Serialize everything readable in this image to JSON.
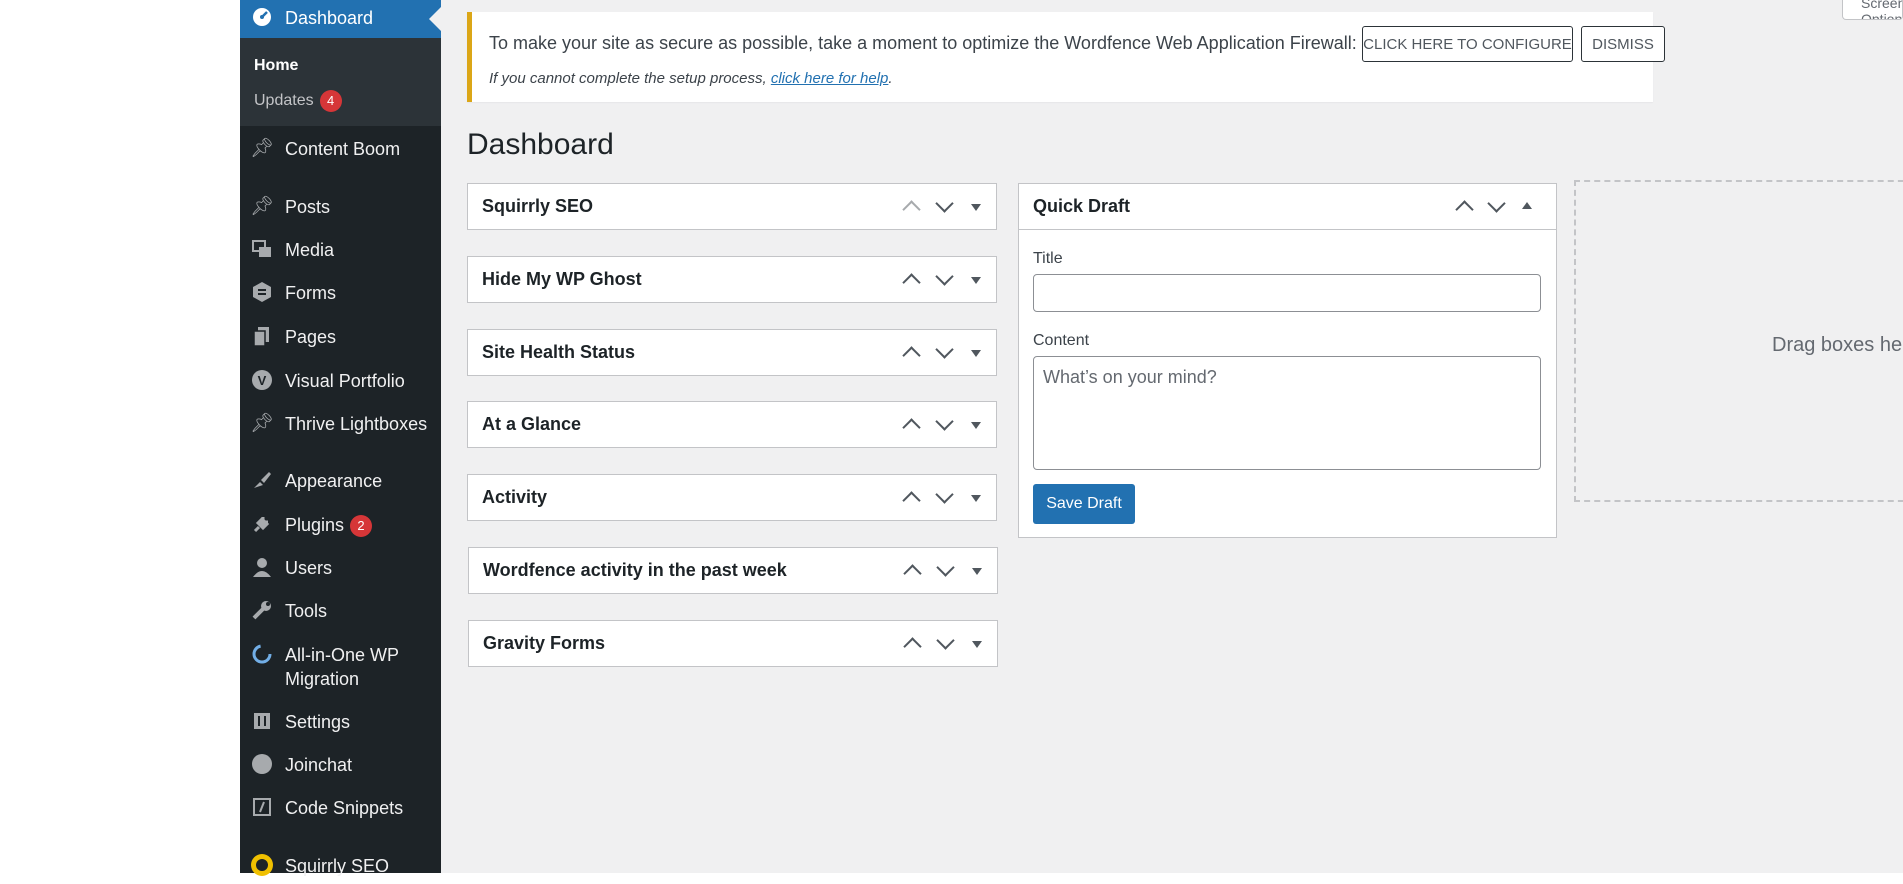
{
  "sidebar": {
    "dashboard_label": "Dashboard",
    "submenu": {
      "home": "Home",
      "updates": "Updates",
      "updates_count": "4"
    },
    "items": [
      {
        "label": "Content Boom",
        "icon": "pin-icon"
      },
      {
        "label": "Posts",
        "icon": "pin-icon"
      },
      {
        "label": "Media",
        "icon": "media-icon"
      },
      {
        "label": "Forms",
        "icon": "forms-icon"
      },
      {
        "label": "Pages",
        "icon": "pages-icon"
      },
      {
        "label": "Visual Portfolio",
        "icon": "visual-portfolio-icon"
      },
      {
        "label": "Thrive Lightboxes",
        "icon": "pin-icon"
      },
      {
        "label": "Appearance",
        "icon": "brush-icon"
      },
      {
        "label": "Plugins",
        "icon": "plugin-icon",
        "badge": "2"
      },
      {
        "label": "Users",
        "icon": "user-icon"
      },
      {
        "label": "Tools",
        "icon": "wrench-icon"
      },
      {
        "label": "All-in-One WP",
        "label2": "Migration",
        "icon": "migration-icon"
      },
      {
        "label": "Settings",
        "icon": "settings-icon"
      },
      {
        "label": "Joinchat",
        "icon": "chat-icon"
      },
      {
        "label": "Code Snippets",
        "icon": "code-icon"
      },
      {
        "label": "Squirrly SEO",
        "icon": "squirrly-icon"
      }
    ]
  },
  "notice": {
    "text": "To make your site as secure as possible, take a moment to optimize the Wordfence Web Application Firewall:",
    "configure_label": "CLICK HERE TO CONFIGURE",
    "dismiss_label": "DISMISS",
    "help_prefix": "If you cannot complete the setup process, ",
    "help_link": "click here for help",
    "help_suffix": "."
  },
  "screen_options_label": "Screen Options",
  "page_title": "Dashboard",
  "widgets": [
    "Squirrly SEO",
    "Hide My WP Ghost",
    "Site Health Status",
    "At a Glance",
    "Activity",
    "Wordfence activity in the past week",
    "Gravity Forms"
  ],
  "quick_draft": {
    "title": "Quick Draft",
    "title_label": "Title",
    "title_value": "",
    "content_label": "Content",
    "content_placeholder": "What’s on your mind?",
    "save_label": "Save Draft"
  },
  "dropzone_text": "Drag boxes here"
}
